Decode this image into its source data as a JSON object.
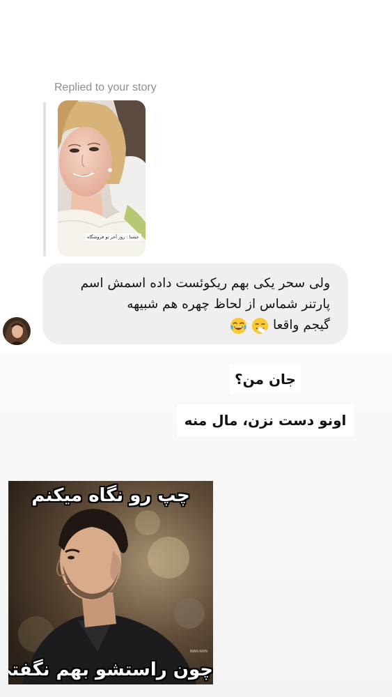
{
  "reply": {
    "label": "Replied to your story",
    "story_caption": "جشنا : روز آخر تو فروشگاه"
  },
  "message": {
    "lines": [
      "ولی سحر یکی بهم ریکوئست داده اسمش اسم",
      "پارتنر شماس از لحاظ چهره هم شبیهه",
      "گیجم واقعا"
    ],
    "emojis": [
      "sneezing-face-emoji",
      "tears-of-joy-emoji"
    ]
  },
  "stickers": {
    "first": "جان من؟",
    "second": "اونو دست نزن، مال منه"
  },
  "meme": {
    "top_text": "چپ رو نگاه میکنم",
    "bottom_text": "چون راستشو بهم نگفتی",
    "credit": "IMAN ARIN"
  },
  "colors": {
    "bubble": "#efefef",
    "label": "#8e8e8e",
    "reply_bar": "#e3e3e3"
  }
}
